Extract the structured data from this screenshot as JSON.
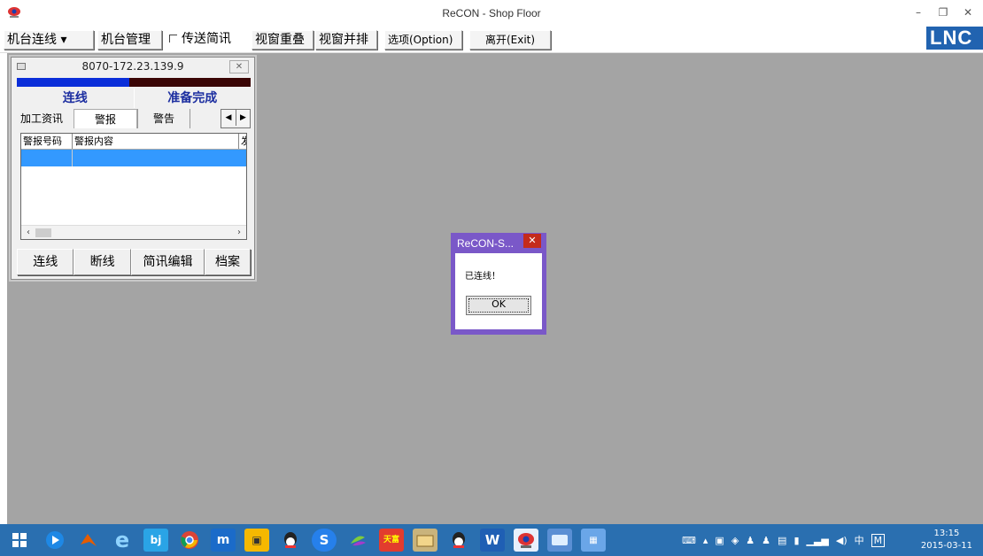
{
  "window": {
    "title": "ReCON - Shop Floor"
  },
  "menubar": {
    "machine_connect": "机台连线",
    "machine_manage": "机台管理",
    "send_message": "传送简讯",
    "cascade": "视窗重叠",
    "tile": "视窗并排",
    "options": "选项(Option)",
    "exit": "离开(Exit)"
  },
  "logo": {
    "text": "LNC",
    "color": "#2163b0"
  },
  "mdi": {
    "title": "8070-172.23.139.9",
    "progress": 0.48,
    "status_connection": "连线",
    "status_state": "准备完成",
    "tabs": [
      "加工资讯",
      "警报",
      "警告"
    ],
    "selected_tab": "警报",
    "columns": [
      "警报号码",
      "警报内容",
      "发"
    ],
    "buttons": [
      "连线",
      "断线",
      "简讯编辑",
      "档案"
    ]
  },
  "dialog": {
    "title": "ReCON-S...",
    "message": "已连线！",
    "ok": "OK",
    "accent": "#7a58c8"
  },
  "taskbar": {
    "apps": [
      "start-icon",
      "media-player-icon",
      "matlab-icon",
      "ie-icon",
      "app-icon",
      "chrome-icon",
      "maxthon-icon",
      "app-icon",
      "qq-icon",
      "sogou-icon",
      "app-icon",
      "stock-icon",
      "explorer-icon",
      "qq-icon",
      "word-icon",
      "recon-icon",
      "app-icon",
      "control-panel-icon"
    ],
    "ime_cn": "中",
    "ime_m": "M",
    "time": "13:15",
    "date": "2015-03-11",
    "color": "#2a6fb0"
  }
}
